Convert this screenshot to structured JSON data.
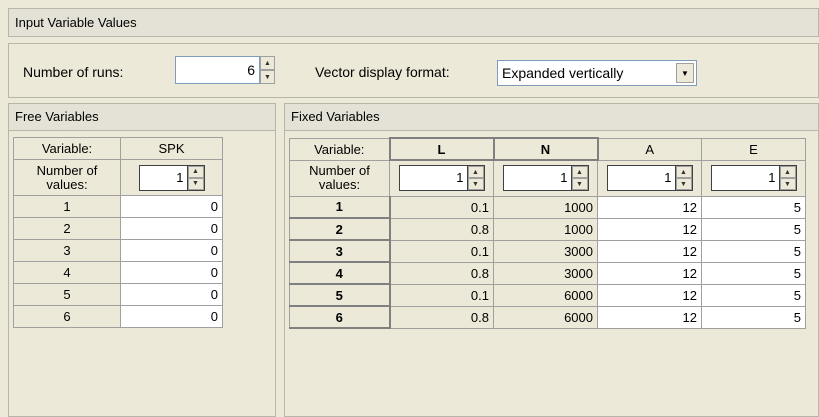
{
  "title": "Input Variable Values",
  "runs": {
    "label": "Number of runs:",
    "value": "6"
  },
  "vector": {
    "label": "Vector display format:",
    "value": "Expanded vertically"
  },
  "free": {
    "title": "Free Variables",
    "var_header": "Variable:",
    "num_header": "Number of values:",
    "columns": [
      {
        "name": "SPK",
        "num": "1"
      }
    ],
    "rows": [
      {
        "label": "1",
        "values": [
          "0"
        ]
      },
      {
        "label": "2",
        "values": [
          "0"
        ]
      },
      {
        "label": "3",
        "values": [
          "0"
        ]
      },
      {
        "label": "4",
        "values": [
          "0"
        ]
      },
      {
        "label": "5",
        "values": [
          "0"
        ]
      },
      {
        "label": "6",
        "values": [
          "0"
        ]
      }
    ]
  },
  "fixed": {
    "title": "Fixed Variables",
    "var_header": "Variable:",
    "num_header": "Number of values:",
    "columns": [
      {
        "name": "L",
        "num": "1"
      },
      {
        "name": "N",
        "num": "1"
      },
      {
        "name": "A",
        "num": "1"
      },
      {
        "name": "E",
        "num": "1"
      }
    ],
    "rows": [
      {
        "label": "1",
        "values": [
          "0.1",
          "1000",
          "12",
          "5"
        ]
      },
      {
        "label": "2",
        "values": [
          "0.8",
          "1000",
          "12",
          "5"
        ]
      },
      {
        "label": "3",
        "values": [
          "0.1",
          "3000",
          "12",
          "5"
        ]
      },
      {
        "label": "4",
        "values": [
          "0.8",
          "3000",
          "12",
          "5"
        ]
      },
      {
        "label": "5",
        "values": [
          "0.1",
          "6000",
          "12",
          "5"
        ]
      },
      {
        "label": "6",
        "values": [
          "0.8",
          "6000",
          "12",
          "5"
        ]
      }
    ]
  }
}
